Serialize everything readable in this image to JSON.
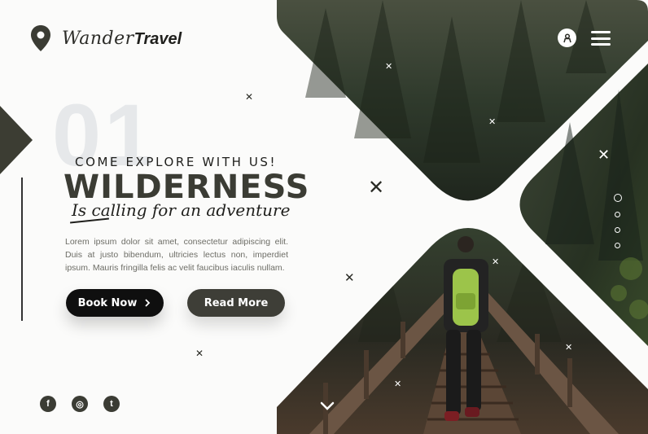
{
  "brand": {
    "script": "Wander",
    "bold": "Travel"
  },
  "hero": {
    "number": "01",
    "kicker": "COME EXPLORE WITH US!",
    "headline": "WILDERNESS",
    "tagline": "Is calling for an adventure",
    "body": "Lorem ipsum dolor sit amet, consectetur adipiscing elit. Duis at justo bibendum, ultricies lectus non, imperdiet ipsum. Mauris fringilla felis ac velit faucibus iaculis nullam."
  },
  "buttons": {
    "book": "Book Now",
    "read": "Read More"
  },
  "social": [
    {
      "name": "facebook-icon",
      "glyph": "f"
    },
    {
      "name": "instagram-icon",
      "glyph": "◎"
    },
    {
      "name": "twitter-icon",
      "glyph": "t"
    }
  ],
  "icons": {
    "user": "user-icon",
    "menu": "hamburger-menu-icon",
    "down": "chevron-down-icon"
  },
  "slider": {
    "total": 4,
    "active": 1
  },
  "colors": {
    "dark": "#3b3c34",
    "black": "#0f0f0f",
    "muted_text": "#6d6d66",
    "ghost_number": "#e6e8ea"
  }
}
